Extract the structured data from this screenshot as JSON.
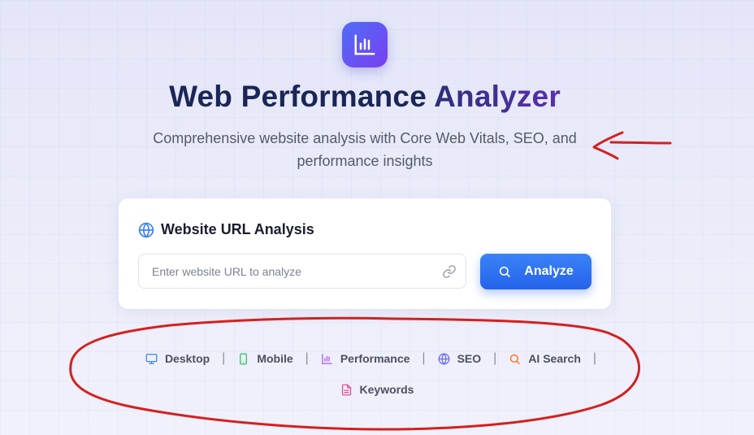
{
  "header": {
    "title_main": "Web Performance",
    "title_accent": "Analyzer",
    "subtitle": "Comprehensive website analysis with Core Web Vitals, SEO, and performance insights",
    "logo_icon": "bar-chart-icon"
  },
  "card": {
    "heading": "Website URL Analysis",
    "heading_icon": "globe-icon",
    "url_placeholder": "Enter website URL to analyze",
    "url_value": "",
    "link_icon": "link-icon",
    "analyze_label": "Analyze",
    "analyze_icon": "search-icon"
  },
  "features": [
    {
      "label": "Desktop",
      "icon": "monitor-icon",
      "color": "#3b82f6"
    },
    {
      "label": "Mobile",
      "icon": "smartphone-icon",
      "color": "#22c55e"
    },
    {
      "label": "Performance",
      "icon": "bar-chart-icon",
      "color": "#a855f7"
    },
    {
      "label": "SEO",
      "icon": "globe-icon",
      "color": "#6366f1"
    },
    {
      "label": "AI Search",
      "icon": "search-icon",
      "color": "#f97316"
    },
    {
      "label": "Keywords",
      "icon": "file-text-icon",
      "color": "#ec4899"
    }
  ],
  "separator": "|",
  "colors": {
    "accent": "#2563eb",
    "logo_gradient_start": "#4f6df5",
    "logo_gradient_end": "#7a3ff2",
    "title": "#1b2657",
    "annotation": "#d42020"
  }
}
